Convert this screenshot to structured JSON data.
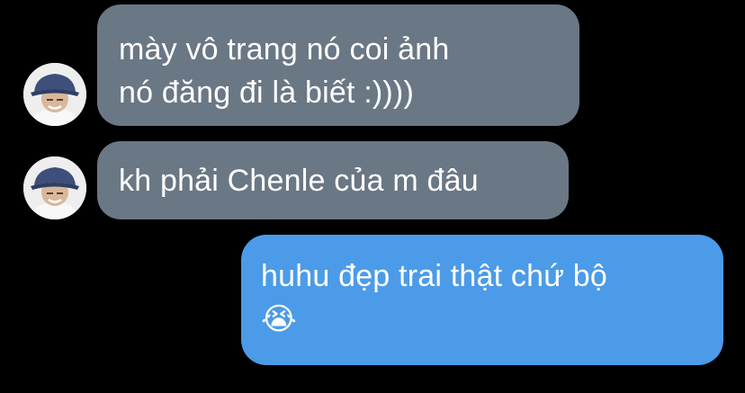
{
  "conversation": {
    "messages": [
      {
        "sender": "other",
        "lines": [
          "mày vô trang nó coi ảnh",
          "nó đăng đi là biết :))))"
        ]
      },
      {
        "sender": "other",
        "lines": [
          "kh phải Chenle của m đâu"
        ]
      },
      {
        "sender": "me",
        "lines": [
          "huhu đẹp trai thật chứ bộ",
          "😭"
        ]
      }
    ]
  },
  "colors": {
    "background": "#000000",
    "incoming_bubble": "#6a7784",
    "outgoing_bubble": "#4b9be8",
    "text": "#ffffff"
  },
  "icons": {
    "avatar": "user-avatar-icon",
    "emoji": "loudly-crying-face"
  }
}
